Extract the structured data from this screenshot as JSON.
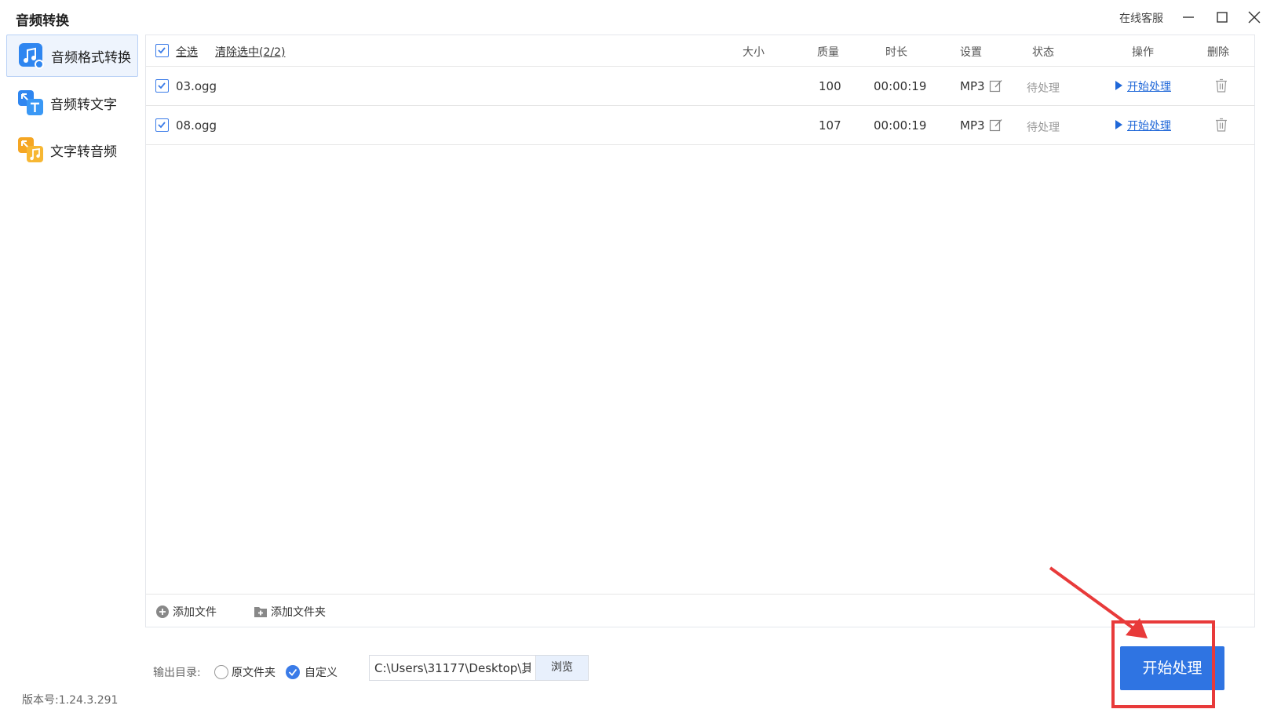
{
  "app": {
    "title": "音频转换",
    "support": "在线客服"
  },
  "sidebar": {
    "items": [
      {
        "label": "音频格式转换",
        "icon": "music-convert-icon",
        "active": true
      },
      {
        "label": "音频转文字",
        "icon": "audio-to-text-icon",
        "active": false
      },
      {
        "label": "文字转音频",
        "icon": "text-to-audio-icon",
        "active": false
      }
    ],
    "version": "版本号:1.24.3.291"
  },
  "table": {
    "select_all": "全选",
    "clear_selected": "清除选中(2/2)",
    "headers": {
      "size": "大小",
      "quality": "质量",
      "duration": "时长",
      "settings": "设置",
      "status": "状态",
      "action": "操作",
      "delete": "删除"
    },
    "rows": [
      {
        "name": "03.ogg",
        "size": "",
        "quality": "100",
        "duration": "00:00:19",
        "format": "MP3",
        "status": "待处理",
        "action": "开始处理",
        "checked": true
      },
      {
        "name": "08.ogg",
        "size": "",
        "quality": "107",
        "duration": "00:00:19",
        "format": "MP3",
        "status": "待处理",
        "action": "开始处理",
        "checked": true
      }
    ]
  },
  "footer": {
    "add_file": "添加文件",
    "add_folder": "添加文件夹"
  },
  "output": {
    "label": "输出目录:",
    "options": [
      {
        "label": "原文件夹",
        "selected": false
      },
      {
        "label": "自定义",
        "selected": true
      }
    ],
    "path": "C:\\Users\\31177\\Desktop\\其",
    "browse": "浏览"
  },
  "start_button": "开始处理",
  "colors": {
    "accent": "#2f74e2",
    "annotation": "#e83a3a",
    "link": "#1f67d8"
  }
}
